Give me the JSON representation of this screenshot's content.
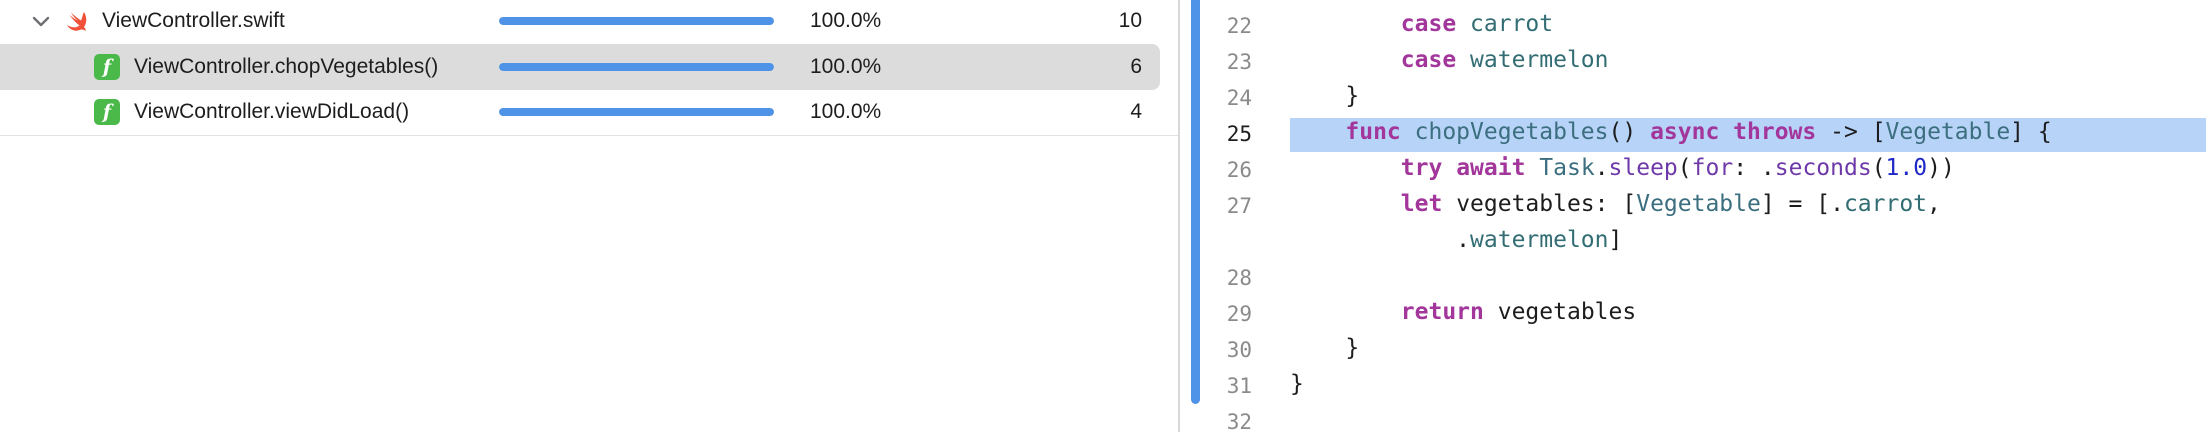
{
  "rows": [
    {
      "label": "ViewController.swift",
      "progress": 1.0,
      "percent": "100.0%",
      "count": "10"
    },
    {
      "label": "ViewController.chopVegetables()",
      "progress": 1.0,
      "percent": "100.0%",
      "count": "6"
    },
    {
      "label": "ViewController.viewDidLoad()",
      "progress": 1.0,
      "percent": "100.0%",
      "count": "4"
    }
  ],
  "icons": {
    "chevron": "chevron-down-icon",
    "swift": "swift-file-icon",
    "function": "function-icon",
    "function_glyph": "f"
  },
  "editor": {
    "line_numbers": [
      "22",
      "23",
      "24",
      "25",
      "26",
      "27",
      "28",
      "29",
      "30",
      "31",
      "32"
    ],
    "active_line": "25",
    "tokens": {
      "case": "case",
      "carrot": "carrot",
      "watermelon": "watermelon",
      "close_brace": "}",
      "func": "func",
      "chopVegetables": "chopVegetables",
      "parens": "() ",
      "async": "async",
      "throws": "throws",
      "arrow": "->",
      "lbracket": "[",
      "Vegetable": "Vegetable",
      "rbracket_brace": "] {",
      "try": "try",
      "await": "await",
      "Task": "Task",
      "dot": ".",
      "sleep": "sleep",
      "lparen": "(",
      "for": "for",
      "colon_dot": ": .",
      "seconds": "seconds",
      "one": "1.0",
      "rparens": "))",
      "let": "let",
      "vegetables_decl": "vegetables: ",
      "eq_lbracket_dot": "] = [.",
      "comma": ",",
      "dot2": ".",
      "rbracket": "]",
      "return": "return",
      "vegetables": "vegetables"
    }
  },
  "colors": {
    "accent": "#4f93e8",
    "selection": "#dcdcdc",
    "line_highlight": "#b7d3f7",
    "keyword": "#a2369b",
    "type": "#3b6e7f",
    "function_icon": "#4bb84a"
  }
}
